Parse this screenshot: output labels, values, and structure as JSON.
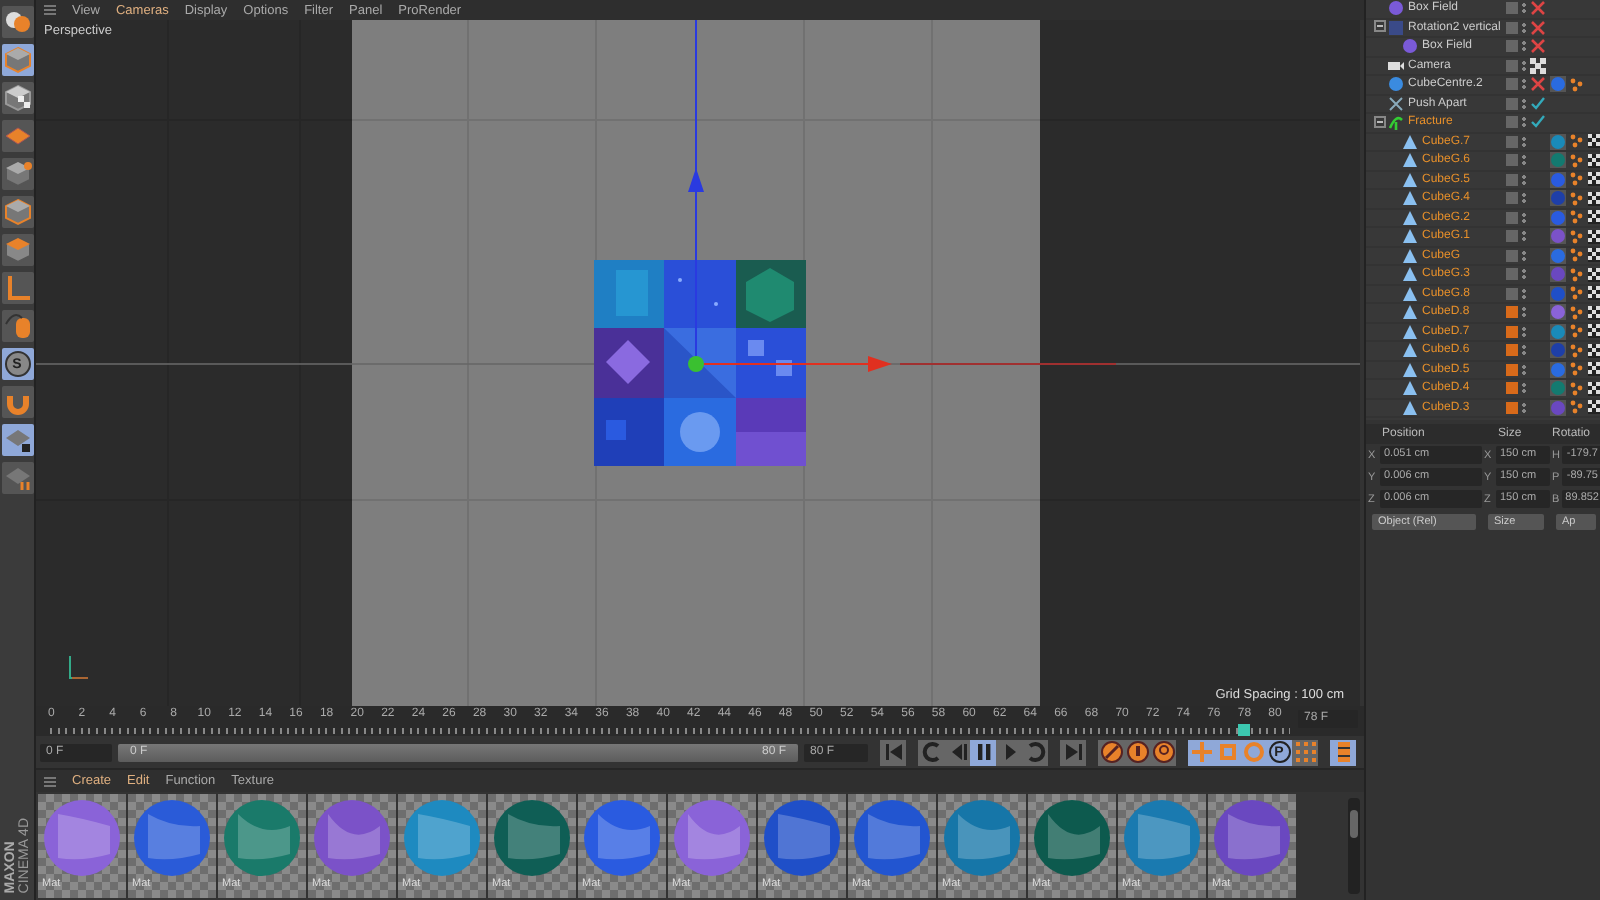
{
  "toolbar": [
    {
      "kind": "undo",
      "selected": false
    },
    {
      "kind": "cube",
      "selected": true
    },
    {
      "kind": "checker-cube",
      "selected": false
    },
    {
      "kind": "plane",
      "selected": false
    },
    {
      "kind": "cube-dot",
      "selected": false
    },
    {
      "kind": "cube",
      "selected": false
    },
    {
      "kind": "cube-top",
      "selected": false
    },
    {
      "kind": "axis",
      "selected": false
    },
    {
      "kind": "mouse",
      "selected": false
    },
    {
      "kind": "snap",
      "label": "S",
      "selected": true
    },
    {
      "kind": "magnet",
      "selected": false
    },
    {
      "kind": "plane-lock",
      "selected": true
    },
    {
      "kind": "plane-axis",
      "selected": false
    }
  ],
  "logo": {
    "line_1": "MAXON",
    "line_2": "CINEMA 4D"
  },
  "viewport": {
    "menu": [
      {
        "label": "View",
        "highlighted": false
      },
      {
        "label": "Cameras",
        "highlighted": true
      },
      {
        "label": "Display",
        "highlighted": false
      },
      {
        "label": "Options",
        "highlighted": false
      },
      {
        "label": "Filter",
        "highlighted": false
      },
      {
        "label": "Panel",
        "highlighted": false
      },
      {
        "label": "ProRender",
        "highlighted": false
      }
    ],
    "camera": "Perspective",
    "grid_spacing": "Grid Spacing : 100 cm"
  },
  "timeline": {
    "ticks": [
      "0",
      "2",
      "4",
      "6",
      "8",
      "10",
      "12",
      "14",
      "16",
      "18",
      "20",
      "22",
      "24",
      "26",
      "28",
      "30",
      "32",
      "34",
      "36",
      "38",
      "40",
      "42",
      "44",
      "46",
      "48",
      "50",
      "52",
      "54",
      "56",
      "58",
      "60",
      "62",
      "64",
      "66",
      "68",
      "70",
      "72",
      "74",
      "76",
      "78",
      "80"
    ],
    "level": 0.975,
    "current_frame": "78 F",
    "start_field": "0 F",
    "range": {
      "start": "0 F",
      "end": "80 F",
      "level": 1
    },
    "end_field": "80 F",
    "controls": [
      {
        "kind": "first",
        "selected": false
      },
      {
        "kind": "prev-key",
        "selected": false
      },
      {
        "kind": "prev-frame",
        "selected": false
      },
      {
        "kind": "pause",
        "selected": true
      },
      {
        "kind": "next-frame",
        "selected": false
      },
      {
        "kind": "next-key",
        "selected": false
      },
      {
        "kind": "last",
        "selected": false
      },
      {
        "kind": "keyframe",
        "selected": false
      },
      {
        "kind": "record",
        "selected": false
      },
      {
        "kind": "auto-key",
        "selected": false
      },
      {
        "kind": "move",
        "selected": true
      },
      {
        "kind": "scale",
        "selected": true
      },
      {
        "kind": "rotate",
        "selected": true
      },
      {
        "kind": "param",
        "label": "P",
        "selected": true
      },
      {
        "kind": "points",
        "selected": false
      },
      {
        "kind": "film",
        "selected": true
      }
    ]
  },
  "materials": {
    "menu": [
      {
        "label": "Create",
        "highlighted": true
      },
      {
        "label": "Edit",
        "highlighted": true
      },
      {
        "label": "Function",
        "highlighted": false
      },
      {
        "label": "Texture",
        "highlighted": false
      }
    ],
    "items": [
      {
        "name": "Mat",
        "color": "#8a63d8"
      },
      {
        "name": "Mat",
        "color": "#2a5bd8"
      },
      {
        "name": "Mat",
        "color": "#1a7a6a"
      },
      {
        "name": "Mat",
        "color": "#7b52c8"
      },
      {
        "name": "Mat",
        "color": "#1e8ac0"
      },
      {
        "name": "Mat",
        "color": "#0f5e55"
      },
      {
        "name": "Mat",
        "color": "#2a5be0"
      },
      {
        "name": "Mat",
        "color": "#8a63d8"
      },
      {
        "name": "Mat",
        "color": "#1f4fc8"
      },
      {
        "name": "Mat",
        "color": "#2255d0"
      },
      {
        "name": "Mat",
        "color": "#1676a8"
      },
      {
        "name": "Mat",
        "color": "#0d5a4e"
      },
      {
        "name": "Mat",
        "color": "#1a7ab0"
      },
      {
        "name": "Mat",
        "color": "#6a48c0"
      }
    ]
  },
  "objects": [
    {
      "name": "Box Field",
      "kind": "field",
      "enabled": false,
      "highlighted": false
    },
    {
      "name": "Rotation2 vertical",
      "kind": "rotation",
      "enabled": false,
      "highlighted": false,
      "expanded": true,
      "children": [
        {
          "name": "Box Field",
          "kind": "field",
          "enabled": false,
          "highlighted": false
        }
      ]
    },
    {
      "name": "Camera",
      "kind": "camera",
      "highlighted": false
    },
    {
      "name": "CubeCentre.2",
      "kind": "sphere",
      "enabled": false,
      "highlighted": false,
      "color": "#2a6be0"
    },
    {
      "name": "Push Apart",
      "kind": "push",
      "enabled": true,
      "highlighted": false
    },
    {
      "name": "Fracture",
      "kind": "fracture",
      "enabled": true,
      "highlighted": true,
      "expanded": true,
      "children": [
        {
          "name": "CubeG.7",
          "kind": "cloner",
          "highlighted": true,
          "layer": false,
          "color": "#1a8ab8"
        },
        {
          "name": "CubeG.6",
          "kind": "cloner",
          "highlighted": true,
          "layer": false,
          "color": "#137a70"
        },
        {
          "name": "CubeG.5",
          "kind": "cloner",
          "highlighted": true,
          "layer": false,
          "color": "#2a5be0"
        },
        {
          "name": "CubeG.4",
          "kind": "cloner",
          "highlighted": true,
          "layer": false,
          "color": "#1e3fa8"
        },
        {
          "name": "CubeG.2",
          "kind": "cloner",
          "highlighted": true,
          "layer": false,
          "color": "#2a5be0"
        },
        {
          "name": "CubeG.1",
          "kind": "cloner",
          "highlighted": true,
          "layer": false,
          "color": "#7b52c8"
        },
        {
          "name": "CubeG",
          "kind": "cloner",
          "highlighted": true,
          "layer": false,
          "color": "#2a6be0"
        },
        {
          "name": "CubeG.3",
          "kind": "cloner",
          "highlighted": true,
          "layer": false,
          "color": "#6a48c0"
        },
        {
          "name": "CubeG.8",
          "kind": "cloner",
          "highlighted": true,
          "layer": false,
          "color": "#1f4fc8"
        },
        {
          "name": "CubeD.8",
          "kind": "cloner",
          "highlighted": true,
          "layer": true,
          "color": "#8a63d8"
        },
        {
          "name": "CubeD.7",
          "kind": "cloner",
          "highlighted": true,
          "layer": true,
          "color": "#1a8ab8"
        },
        {
          "name": "CubeD.6",
          "kind": "cloner",
          "highlighted": true,
          "layer": true,
          "color": "#1e3fa8"
        },
        {
          "name": "CubeD.5",
          "kind": "cloner",
          "highlighted": true,
          "layer": true,
          "color": "#2a6be0"
        },
        {
          "name": "CubeD.4",
          "kind": "cloner",
          "highlighted": true,
          "layer": true,
          "color": "#137a70"
        },
        {
          "name": "CubeD.3",
          "kind": "cloner",
          "highlighted": true,
          "layer": true,
          "color": "#6a48c0"
        }
      ]
    }
  ],
  "attributes": {
    "columns": [
      "Position",
      "Size",
      "Rotatio"
    ],
    "rows": [
      [
        {
          "label": "X",
          "value": "0.051 cm"
        },
        {
          "label": "X",
          "value": "150 cm"
        },
        {
          "label": "H",
          "value": "-179.7"
        }
      ],
      [
        {
          "label": "Y",
          "value": "0.006 cm"
        },
        {
          "label": "Y",
          "value": "150 cm"
        },
        {
          "label": "P",
          "value": "-89.75"
        }
      ],
      [
        {
          "label": "Z",
          "value": "0.006 cm"
        },
        {
          "label": "Z",
          "value": "150 cm"
        },
        {
          "label": "B",
          "value": "89.852"
        }
      ]
    ],
    "dropdowns": [
      "Object (Rel)",
      "Size"
    ],
    "button": "Ap"
  }
}
